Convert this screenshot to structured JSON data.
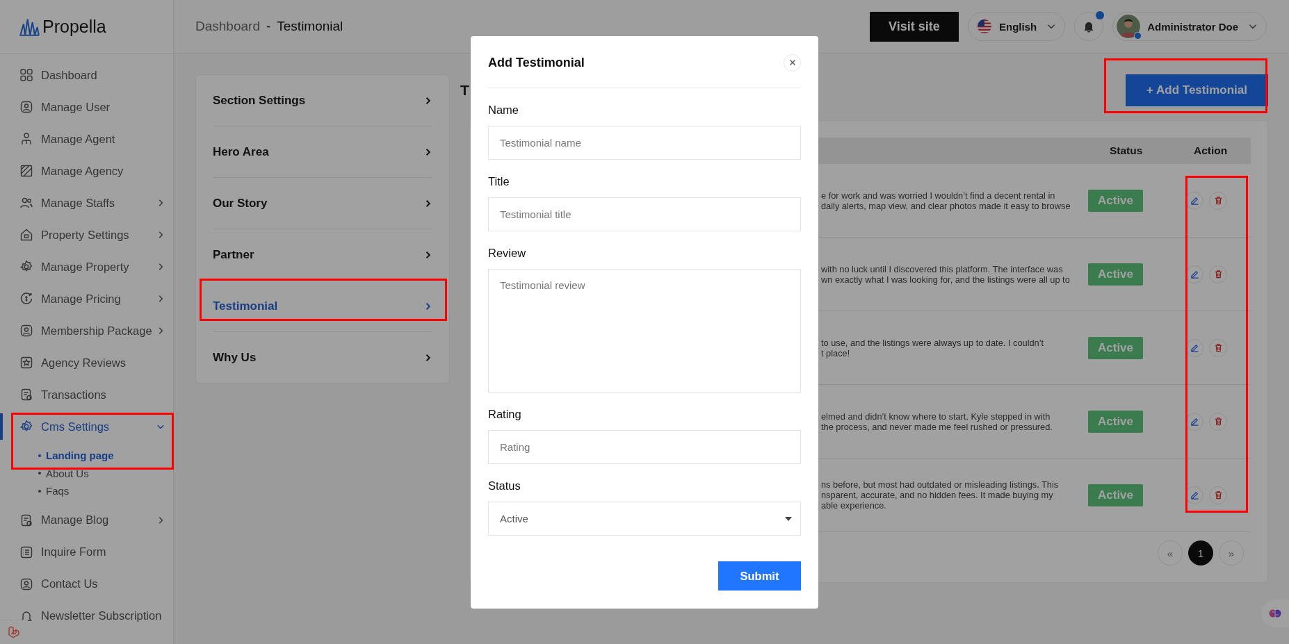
{
  "sidebar": {
    "logo": "Propella",
    "items": [
      {
        "label": "Dashboard",
        "expandable": false,
        "selected": false
      },
      {
        "label": "Manage User",
        "expandable": false,
        "selected": false
      },
      {
        "label": "Manage Agent",
        "expandable": false,
        "selected": false
      },
      {
        "label": "Manage Agency",
        "expandable": false,
        "selected": false
      },
      {
        "label": "Manage Staffs",
        "expandable": true,
        "expanded": false,
        "selected": false
      },
      {
        "label": "Property Settings",
        "expandable": true,
        "expanded": false,
        "selected": false
      },
      {
        "label": "Manage Property",
        "expandable": true,
        "expanded": false,
        "selected": false
      },
      {
        "label": "Manage Pricing",
        "expandable": true,
        "expanded": false,
        "selected": false
      },
      {
        "label": "Membership Package",
        "expandable": true,
        "expanded": false,
        "selected": false
      },
      {
        "label": "Agency Reviews",
        "expandable": false,
        "selected": false
      },
      {
        "label": "Transactions",
        "expandable": false,
        "selected": false
      },
      {
        "label": "Cms Settings",
        "expandable": true,
        "expanded": true,
        "selected": true,
        "children": [
          {
            "label": "Landing page",
            "selected": true
          },
          {
            "label": "About Us",
            "selected": false
          },
          {
            "label": "Faqs",
            "selected": false
          }
        ]
      },
      {
        "label": "Manage Blog",
        "expandable": true,
        "expanded": false,
        "selected": false
      },
      {
        "label": "Inquire Form",
        "expandable": false,
        "selected": false
      },
      {
        "label": "Contact Us",
        "expandable": false,
        "selected": false
      },
      {
        "label": "Newsletter Subscription",
        "expandable": false,
        "selected": false
      }
    ]
  },
  "breadcrumb": {
    "parent": "Dashboard",
    "separator": "-",
    "current": "Testimonial"
  },
  "topbar": {
    "visit_button": "Visit site",
    "language": "English",
    "unread_notifications": true,
    "user": "Administrator Doe"
  },
  "settings_menu": [
    {
      "label": "Section Settings",
      "selected": false
    },
    {
      "label": "Hero Area",
      "selected": false
    },
    {
      "label": "Our Story",
      "selected": false
    },
    {
      "label": "Partner",
      "selected": false
    },
    {
      "label": "Testimonial",
      "selected": true
    },
    {
      "label": "Why Us",
      "selected": false
    }
  ],
  "content": {
    "heading": "T",
    "add_button": "+ Add Testimonial",
    "table": {
      "columns": [
        "Status",
        "Action"
      ],
      "rows": [
        {
          "review_lines": [
            "e for work and was worried I wouldn’t find a decent rental in",
            "daily alerts, map view, and clear photos made it easy to browse"
          ],
          "status": "Active"
        },
        {
          "review_lines": [
            "with no luck until I discovered this platform. The interface was",
            "wn exactly what I was looking for, and the listings were all up to"
          ],
          "status": "Active"
        },
        {
          "review_lines": [
            "to use, and the listings were always up to date. I couldn’t",
            "t place!"
          ],
          "status": "Active"
        },
        {
          "review_lines": [
            "elmed and didn’t know where to start. Kyle stepped in with",
            "the process, and never made me feel rushed or pressured."
          ],
          "status": "Active"
        },
        {
          "review_lines": [
            "ns before, but most had outdated or misleading listings. This",
            "nsparent, accurate, and no hidden fees. It made buying my",
            "able experience."
          ],
          "status": "Active"
        }
      ]
    },
    "pagination": {
      "prev": "«",
      "pages": [
        {
          "label": "1",
          "selected": true
        }
      ],
      "next": "»"
    }
  },
  "modal": {
    "title": "Add Testimonial",
    "fields": [
      {
        "label": "Name",
        "kind": "input",
        "placeholder": "Testimonial name"
      },
      {
        "label": "Title",
        "kind": "input",
        "placeholder": "Testimonial title"
      },
      {
        "label": "Review",
        "kind": "textarea",
        "placeholder": "Testimonial review"
      },
      {
        "label": "Rating",
        "kind": "input",
        "placeholder": "Rating"
      },
      {
        "label": "Status",
        "kind": "select",
        "value": "Active"
      }
    ],
    "submit": "Submit"
  }
}
